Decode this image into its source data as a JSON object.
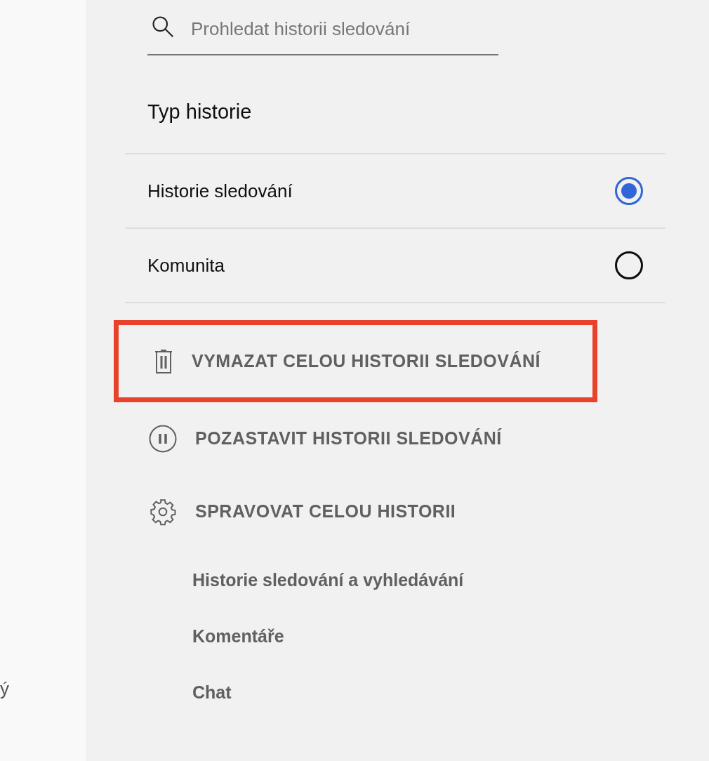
{
  "left_panel": {
    "fragment": "ý"
  },
  "search": {
    "placeholder": "Prohledat historii sledování"
  },
  "history_type": {
    "title": "Typ historie",
    "options": [
      {
        "label": "Historie sledování",
        "selected": true
      },
      {
        "label": "Komunita",
        "selected": false
      }
    ]
  },
  "actions": [
    {
      "kind": "trash",
      "label": "VYMAZAT CELOU HISTORII SLEDOVÁNÍ",
      "highlighted": true
    },
    {
      "kind": "pause",
      "label": "POZASTAVIT HISTORII SLEDOVÁNÍ",
      "highlighted": false
    },
    {
      "kind": "gear",
      "label": "SPRAVOVAT CELOU HISTORII",
      "highlighted": false
    }
  ],
  "manage_links": [
    "Historie sledování a vyhledávání",
    "Komentáře",
    "Chat"
  ]
}
